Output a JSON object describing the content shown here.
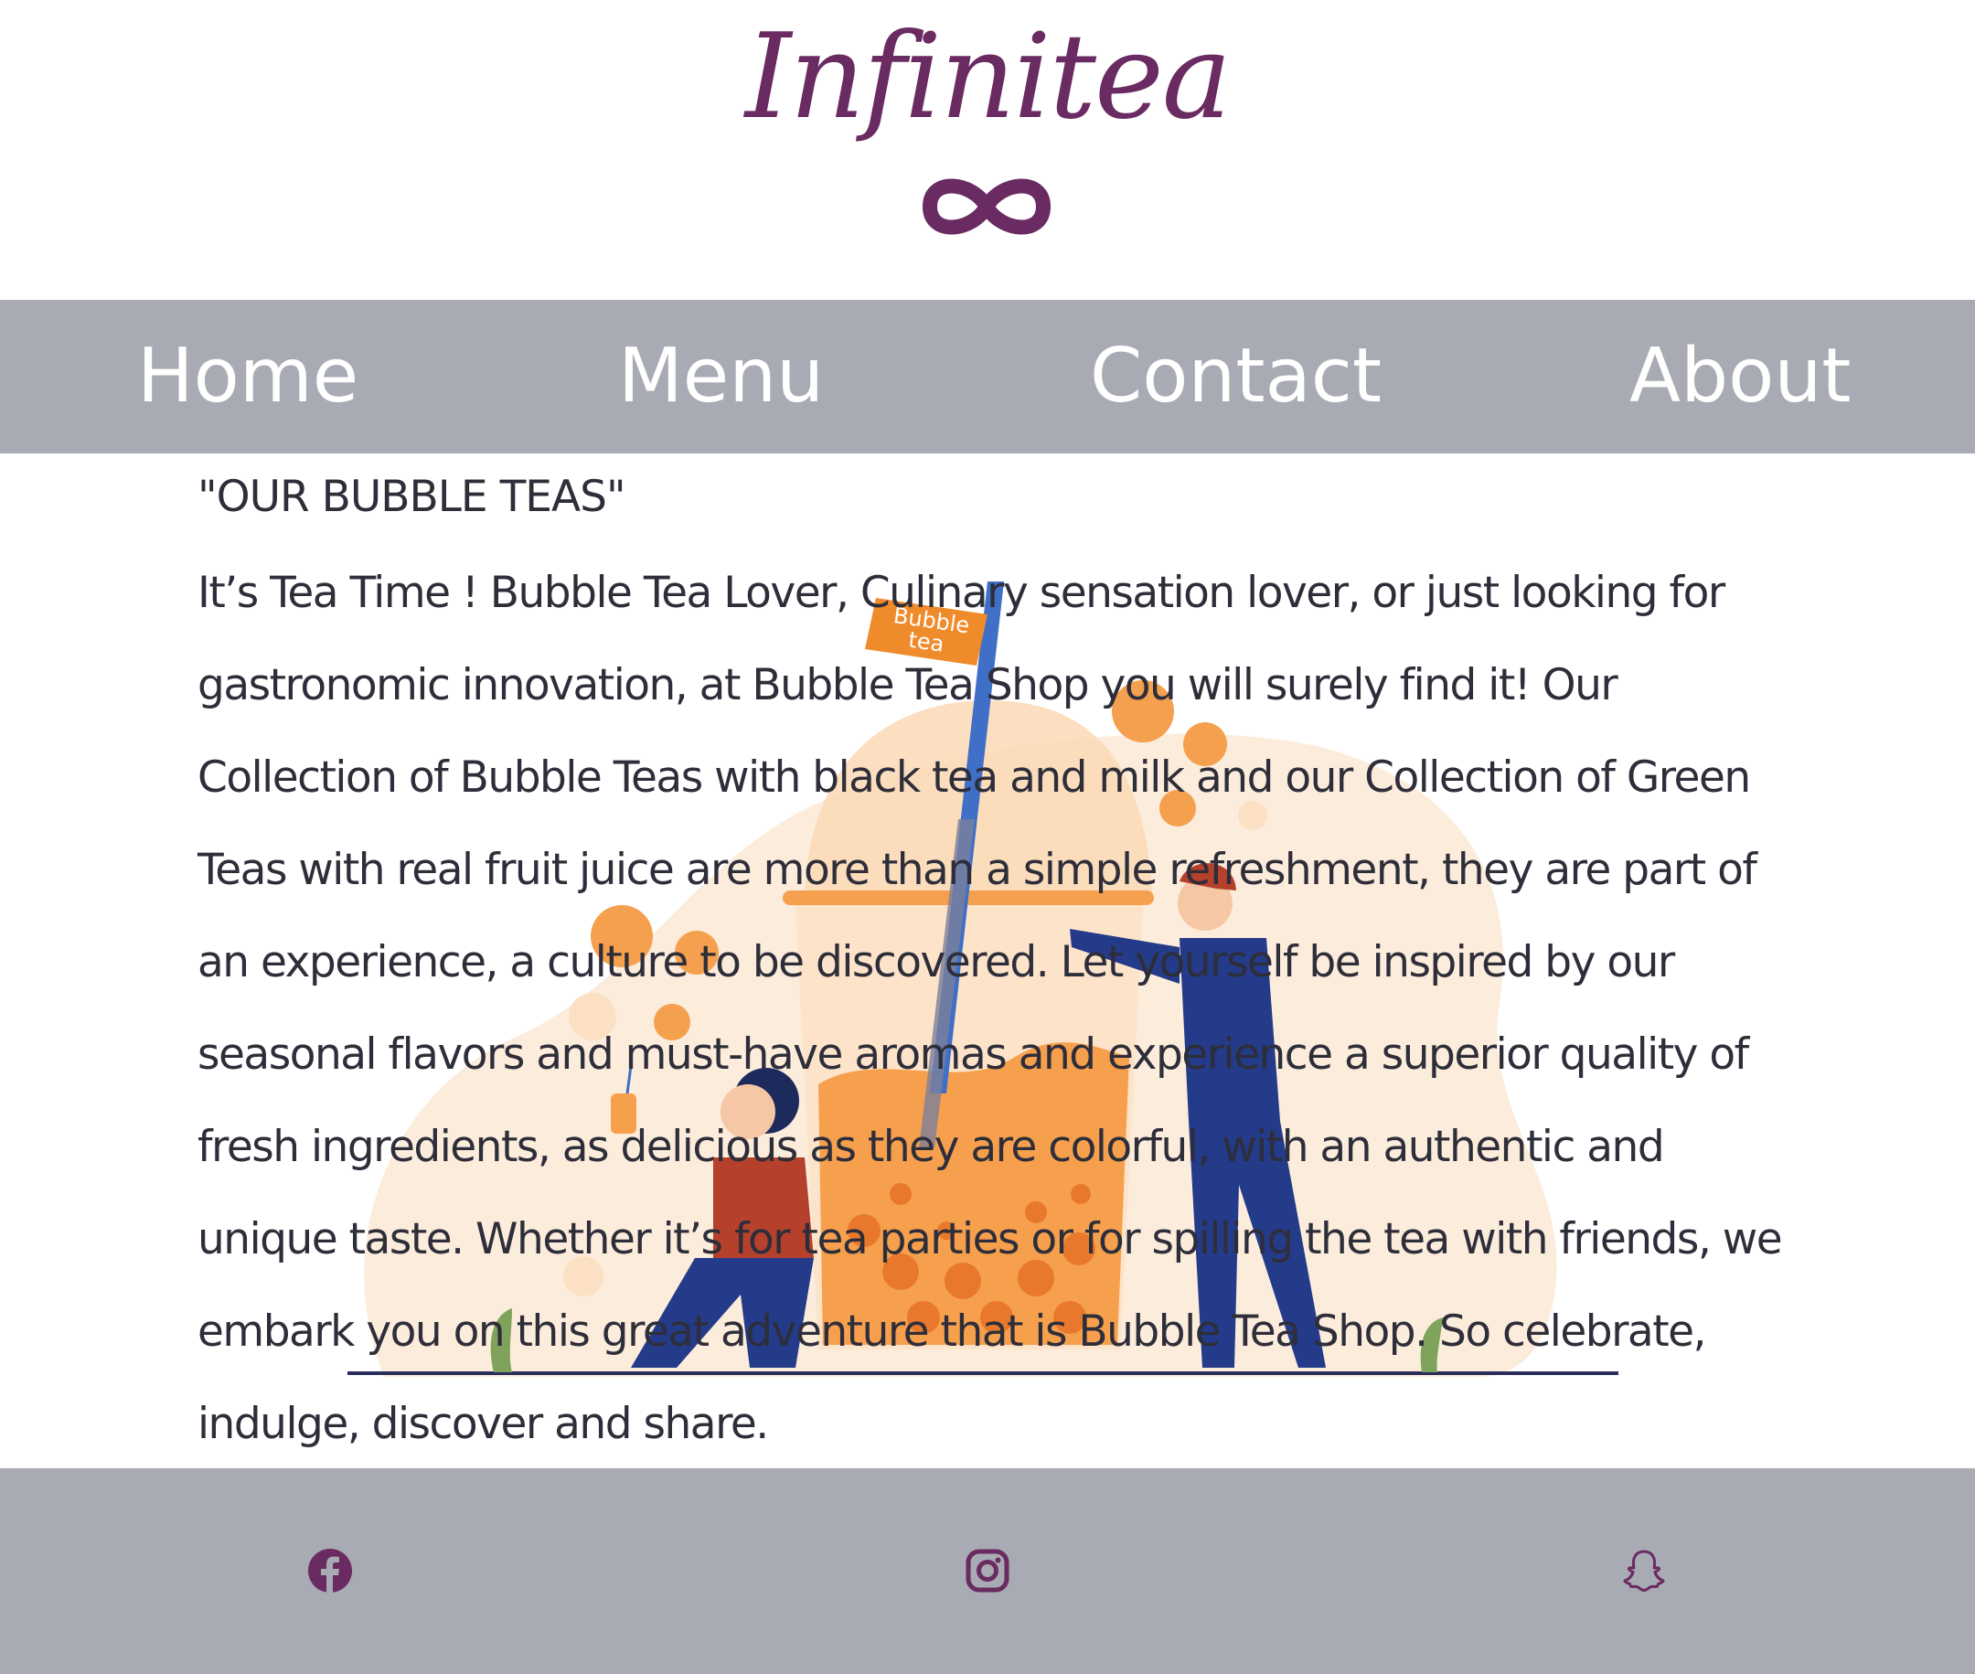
{
  "brand": {
    "name": "Infinitea",
    "symbol": "∞",
    "color": "#6a2a62"
  },
  "nav": {
    "items": [
      {
        "label": "Home"
      },
      {
        "label": "Menu"
      },
      {
        "label": "Contact"
      },
      {
        "label": "About"
      }
    ],
    "background": "#a9abb4"
  },
  "main": {
    "title": "\"OUR BUBBLE TEAS\"",
    "body": "It’s Tea Time ! Bubble Tea Lover, Culinary sensation lover, or just looking for gastronomic innovation, at Bubble Tea Shop you will surely find it! Our Collection of Bubble Teas with black tea and milk and our Collection of Green Teas with real fruit juice are more than a simple refreshment, they are part of an experience, a culture to be discovered. Let yourself be inspired by our seasonal flavors and must-have aromas and experience a superior quality of fresh ingredients, as delicious as they are colorful, with an authentic and unique taste. Whether it’s for tea parties or for spilling the tea with friends, we embark you on this great adventure that is Bubble Tea Shop. So celebrate, indulge, discover and share.",
    "illustration": {
      "cup_sign_line1": "Bubble",
      "cup_sign_line2": "tea"
    }
  },
  "footer": {
    "social": [
      {
        "icon": "facebook-icon"
      },
      {
        "icon": "instagram-icon"
      },
      {
        "icon": "snapchat-icon"
      }
    ]
  }
}
